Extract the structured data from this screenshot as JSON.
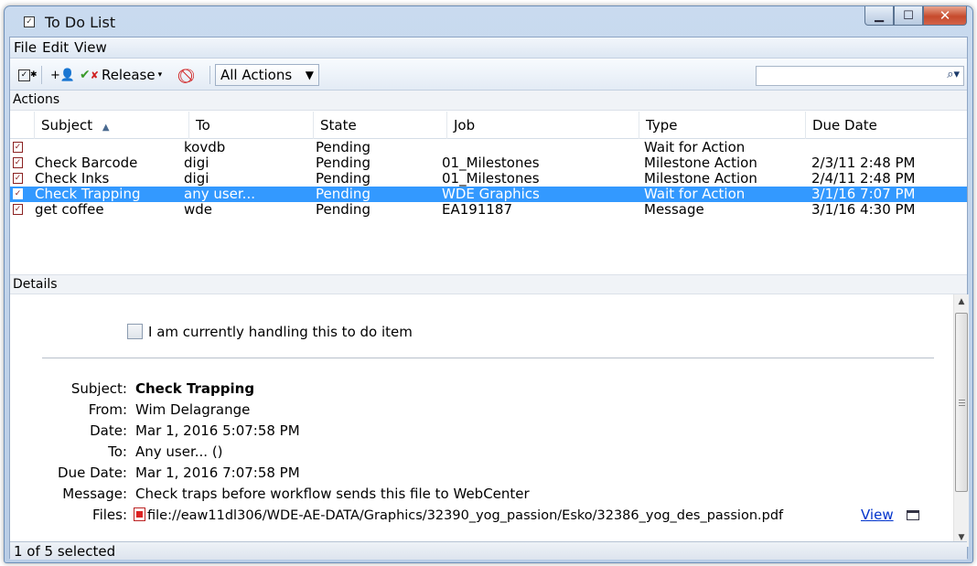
{
  "window": {
    "title": "To Do List"
  },
  "menu": [
    "File",
    "Edit",
    "View"
  ],
  "toolbar": {
    "release_label": "Release",
    "filter_value": "All Actions",
    "search_value": ""
  },
  "sections": {
    "actions": "Actions",
    "details": "Details"
  },
  "columns": [
    "Subject",
    "To",
    "State",
    "Job",
    "Type",
    "Due Date"
  ],
  "rows": [
    {
      "subject": "",
      "to": "kovdb",
      "state": "Pending",
      "job": "",
      "type": "Wait for Action",
      "due": ""
    },
    {
      "subject": "Check Barcode",
      "to": "digi",
      "state": "Pending",
      "job": "01_Milestones",
      "type": "Milestone Action",
      "due": "2/3/11 2:48 PM"
    },
    {
      "subject": "Check Inks",
      "to": "digi",
      "state": "Pending",
      "job": "01_Milestones",
      "type": "Milestone Action",
      "due": "2/4/11 2:48 PM"
    },
    {
      "subject": "Check Trapping",
      "to": "any user...",
      "state": "Pending",
      "job": "WDE Graphics",
      "type": "Wait for Action",
      "due": "3/1/16 7:07 PM",
      "selected": true
    },
    {
      "subject": "get coffee",
      "to": "wde",
      "state": "Pending",
      "job": "EA191187",
      "type": "Message",
      "due": "3/1/16 4:30 PM"
    }
  ],
  "details": {
    "handling_label": "I am currently handling this to do item",
    "handling_checked": false,
    "labels": {
      "subject": "Subject:",
      "from": "From:",
      "date": "Date:",
      "to": "To:",
      "due": "Due Date:",
      "message": "Message:",
      "files": "Files:"
    },
    "subject": "Check Trapping",
    "from": "Wim Delagrange",
    "date": "Mar 1, 2016 5:07:58 PM",
    "to": "Any user... ()",
    "due": "Mar 1, 2016 7:07:58 PM",
    "message": "Check traps before workflow sends this file to WebCenter",
    "file": "file://eaw11dl306/WDE-AE-DATA/Graphics/32390_yog_passion/Esko/32386_yog_des_passion.pdf",
    "view_link": "View"
  },
  "status": "1 of 5 selected",
  "colors": {
    "selection": "#3399ff",
    "link": "#0033cc"
  }
}
